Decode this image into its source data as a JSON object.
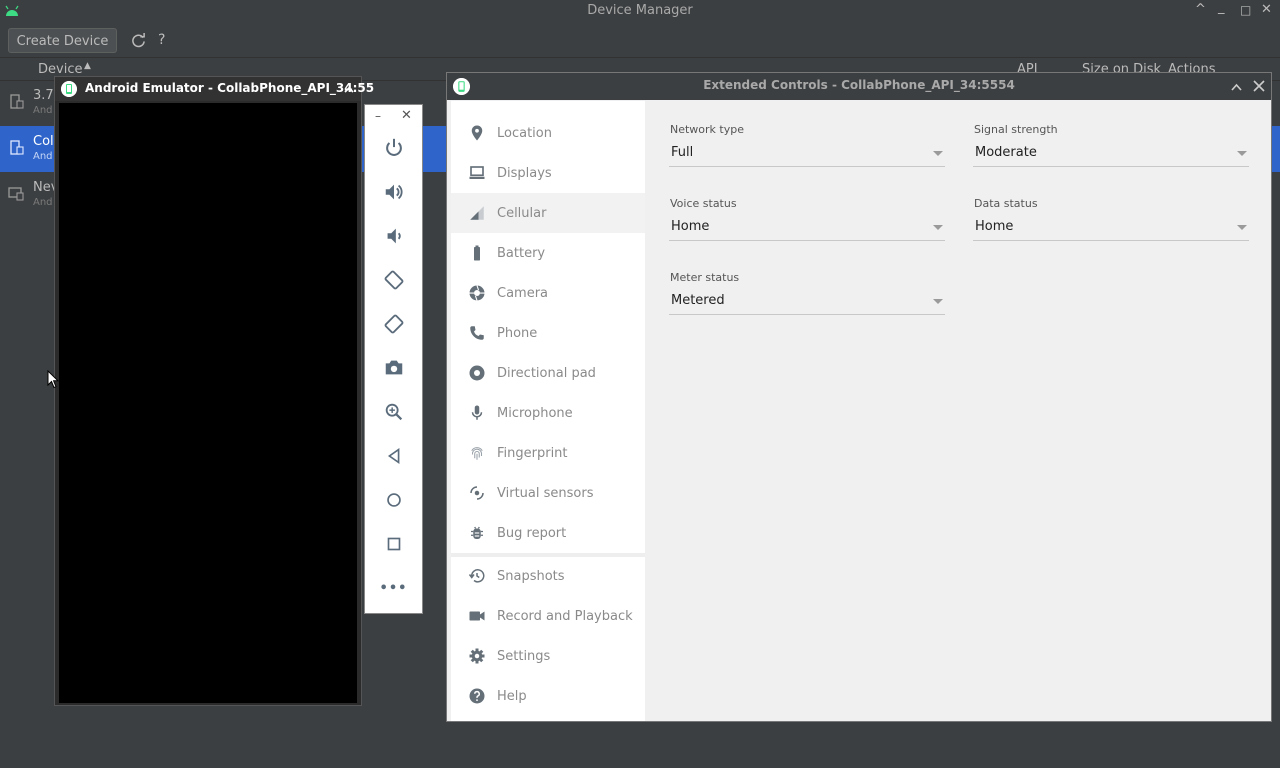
{
  "device_manager": {
    "title": "Device Manager",
    "window_controls": [
      "^",
      "_",
      "□",
      "✕"
    ],
    "toolbar": {
      "create_device_label": "Create Device",
      "refresh_icon": "refresh-icon",
      "help_label": "?"
    },
    "table": {
      "columns": [
        "Device",
        "API",
        "Size on Disk",
        "Actions"
      ],
      "sort_indicator": "▲",
      "rows": [
        {
          "name": "3.7",
          "sub": "And"
        },
        {
          "name": "Col",
          "sub": "And"
        },
        {
          "name": "Nev",
          "sub": "And"
        }
      ]
    }
  },
  "emulator": {
    "title": "Android Emulator - CollabPhone_API_34:55",
    "collapse_icon": "^",
    "toolbar": {
      "minimize": "–",
      "close": "✕",
      "buttons": [
        "power-icon",
        "volume-up-icon",
        "volume-down-icon",
        "rotate-left-icon",
        "rotate-right-icon",
        "camera-icon",
        "zoom-icon",
        "back-icon",
        "home-icon",
        "overview-icon",
        "more-icon"
      ],
      "more_label": "•••"
    }
  },
  "extended_controls": {
    "title": "Extended Controls - CollabPhone_API_34:5554",
    "nav": [
      {
        "label": "Location",
        "icon": "location-pin-icon"
      },
      {
        "label": "Displays",
        "icon": "display-icon"
      },
      {
        "label": "Cellular",
        "icon": "cellular-signal-icon",
        "active": true
      },
      {
        "label": "Battery",
        "icon": "battery-icon"
      },
      {
        "label": "Camera",
        "icon": "camera-aperture-icon"
      },
      {
        "label": "Phone",
        "icon": "phone-icon"
      },
      {
        "label": "Directional pad",
        "icon": "dpad-icon"
      },
      {
        "label": "Microphone",
        "icon": "microphone-icon"
      },
      {
        "label": "Fingerprint",
        "icon": "fingerprint-icon"
      },
      {
        "label": "Virtual sensors",
        "icon": "virtual-sensors-icon"
      },
      {
        "label": "Bug report",
        "icon": "bug-icon"
      },
      {
        "label": "Snapshots",
        "icon": "history-icon"
      },
      {
        "label": "Record and Playback",
        "icon": "video-camera-icon"
      },
      {
        "label": "Settings",
        "icon": "gear-icon"
      },
      {
        "label": "Help",
        "icon": "help-icon"
      }
    ],
    "cellular": {
      "network_type": {
        "label": "Network type",
        "value": "Full"
      },
      "signal_strength": {
        "label": "Signal strength",
        "value": "Moderate"
      },
      "voice_status": {
        "label": "Voice status",
        "value": "Home"
      },
      "data_status": {
        "label": "Data status",
        "value": "Home"
      },
      "meter_status": {
        "label": "Meter status",
        "value": "Metered"
      }
    }
  },
  "colors": {
    "ide_background": "#3c3f41",
    "selection": "#2f65ca",
    "emulator_screen": "#000000",
    "nav_text": "#8a8a8a",
    "panel_background": "#f0f0f0"
  }
}
